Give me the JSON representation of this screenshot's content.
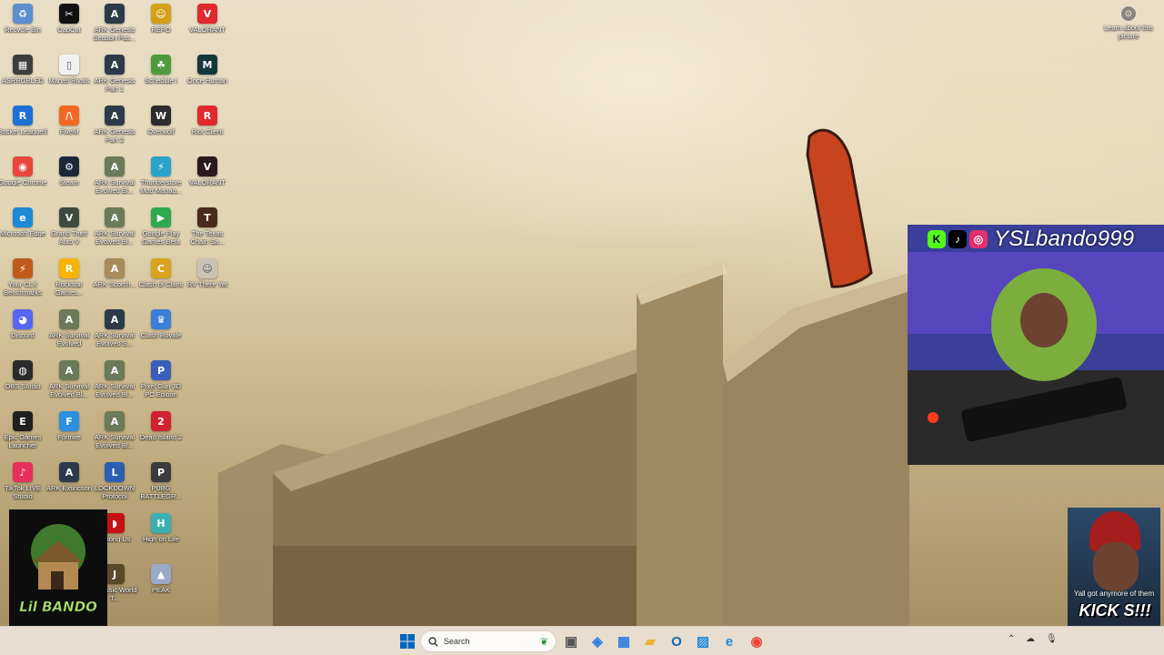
{
  "desktop": {
    "icons": [
      {
        "label": "Recycle Bin",
        "icon": "recycle-bin-icon",
        "color": "#5b8fcf",
        "glyph": "♻"
      },
      {
        "label": "CapCut",
        "icon": "capcut-icon",
        "color": "#111111",
        "glyph": "✂"
      },
      {
        "label": "ARK Genesis Season Pas...",
        "icon": "ark-icon",
        "color": "#2d3a4a",
        "glyph": "A"
      },
      {
        "label": "REPO",
        "icon": "repo-icon",
        "color": "#d4a017",
        "glyph": "☺"
      },
      {
        "label": "VALORANT",
        "icon": "valorant-icon",
        "color": "#e0282e",
        "glyph": "V"
      },
      {
        "label": "ASRRGBLED",
        "icon": "asrock-icon",
        "color": "#3d3d3d",
        "glyph": "▦"
      },
      {
        "label": "Marvel Rivals",
        "icon": "file-icon",
        "color": "#f2f2f2",
        "glyph": "▯"
      },
      {
        "label": "ARK Genesis Part 1",
        "icon": "ark-icon",
        "color": "#2d3a4a",
        "glyph": "A"
      },
      {
        "label": "Schedule I",
        "icon": "schedule-icon",
        "color": "#4e9a3f",
        "glyph": "☘"
      },
      {
        "label": "Once Human",
        "icon": "once-human-icon",
        "color": "#14373a",
        "glyph": "M"
      },
      {
        "label": "Rocket League®",
        "icon": "rocket-league-icon",
        "color": "#1e6fd6",
        "glyph": "R"
      },
      {
        "label": "FiveM",
        "icon": "fivem-icon",
        "color": "#f26722",
        "glyph": "/\\"
      },
      {
        "label": "ARK Genesis Part 2",
        "icon": "ark-icon",
        "color": "#2d3a4a",
        "glyph": "A"
      },
      {
        "label": "Overwolf",
        "icon": "overwolf-icon",
        "color": "#2b2b2b",
        "glyph": "W"
      },
      {
        "label": "Riot Client",
        "icon": "riot-icon",
        "color": "#e0282e",
        "glyph": "R"
      },
      {
        "label": "Google Chrome",
        "icon": "chrome-icon",
        "color": "#e8453c",
        "glyph": "◉"
      },
      {
        "label": "Steam",
        "icon": "steam-icon",
        "color": "#1b2838",
        "glyph": "⚙"
      },
      {
        "label": "ARK Survival Evolved Bl...",
        "icon": "ark-icon",
        "color": "#6b7a58",
        "glyph": "A"
      },
      {
        "label": "Thunderstore Mod Manag...",
        "icon": "thunderstore-icon",
        "color": "#2aa3c9",
        "glyph": "⚡"
      },
      {
        "label": "VALORANT",
        "icon": "valorant-icon",
        "color": "#2a1a1e",
        "glyph": "V"
      },
      {
        "label": "Microsoft Edge",
        "icon": "edge-icon",
        "color": "#1c8ad6",
        "glyph": "e"
      },
      {
        "label": "Grand Theft Auto V",
        "icon": "gta-icon",
        "color": "#3d4a3d",
        "glyph": "V"
      },
      {
        "label": "ARK Survival Evolved Bl...",
        "icon": "ark-icon",
        "color": "#6b7a58",
        "glyph": "A"
      },
      {
        "label": "Google Play Games Beta",
        "icon": "google-play-icon",
        "color": "#2fa84f",
        "glyph": "▶"
      },
      {
        "label": "The Texas Chain Sa...",
        "icon": "texas-chainsaw-icon",
        "color": "#4a2a1a",
        "glyph": "T"
      },
      {
        "label": "Your CLX Benchmarks",
        "icon": "clx-icon",
        "color": "#c05a1a",
        "glyph": "⚡"
      },
      {
        "label": "Rockstar Games...",
        "icon": "rockstar-icon",
        "color": "#f5b400",
        "glyph": "R"
      },
      {
        "label": "ARK Scorch...",
        "icon": "ark-icon",
        "color": "#a88b5a",
        "glyph": "A"
      },
      {
        "label": "Clash of Clans",
        "icon": "clash-of-clans-icon",
        "color": "#d9a21f",
        "glyph": "C"
      },
      {
        "label": "RV There Yet",
        "icon": "rv-icon",
        "color": "#c9c3b3",
        "glyph": "☺"
      },
      {
        "label": "Discord",
        "icon": "discord-icon",
        "color": "#5865f2",
        "glyph": "◕"
      },
      {
        "label": "ARK Survival Evolved",
        "icon": "ark-icon",
        "color": "#6b7a58",
        "glyph": "A"
      },
      {
        "label": "ARK Survival Evolved S...",
        "icon": "ark-icon",
        "color": "#2d3a4a",
        "glyph": "A"
      },
      {
        "label": "Clash Royale",
        "icon": "clash-royale-icon",
        "color": "#3a7fd5",
        "glyph": "♛"
      },
      {
        "label": "OBS Studio",
        "icon": "obs-icon",
        "color": "#2b2b2b",
        "glyph": "◍"
      },
      {
        "label": "ARK Survival Evolved Bl...",
        "icon": "ark-icon",
        "color": "#6b7a58",
        "glyph": "A"
      },
      {
        "label": "ARK Survival Evolved Bl...",
        "icon": "ark-icon",
        "color": "#6b7a58",
        "glyph": "A"
      },
      {
        "label": "Pixel Gun 3D PC Edition",
        "icon": "pixel-gun-icon",
        "color": "#3b5fb8",
        "glyph": "P"
      },
      {
        "label": "Epic Games Launcher",
        "icon": "epic-games-icon",
        "color": "#1f1f1f",
        "glyph": "E"
      },
      {
        "label": "Fortnite",
        "icon": "fortnite-icon",
        "color": "#2c8fe0",
        "glyph": "F"
      },
      {
        "label": "ARK Survival Evolved Bl...",
        "icon": "ark-icon",
        "color": "#6b7a58",
        "glyph": "A"
      },
      {
        "label": "Dead Island 2",
        "icon": "dead-island-icon",
        "color": "#d02232",
        "glyph": "2"
      },
      {
        "label": "TikTok LIVE Studio",
        "icon": "tiktok-live-icon",
        "color": "#e8305a",
        "glyph": "♪"
      },
      {
        "label": "ARK Extinction",
        "icon": "ark-icon",
        "color": "#2d3a4a",
        "glyph": "A"
      },
      {
        "label": "LOCKDOWN Protocol",
        "icon": "lockdown-icon",
        "color": "#2c5fb0",
        "glyph": "L"
      },
      {
        "label": "PUBG BATTLEGR...",
        "icon": "pubg-icon",
        "color": "#3b3b3b",
        "glyph": "P"
      },
      {
        "label": "Among Us",
        "icon": "among-us-icon",
        "color": "#c51111",
        "glyph": "◗"
      },
      {
        "label": "High on Life",
        "icon": "high-on-life-icon",
        "color": "#3cb0b0",
        "glyph": "H"
      },
      {
        "label": "Jurassic World T...",
        "icon": "jurassic-icon",
        "color": "#5a4a2a",
        "glyph": "J"
      },
      {
        "label": "PEAK",
        "icon": "peak-icon",
        "color": "#9aa9c8",
        "glyph": "▲"
      }
    ]
  },
  "learn_about_picture": {
    "label": "Learn about this picture",
    "icon": "camera-icon"
  },
  "stream_overlay": {
    "handle": "YSLbando999",
    "socials": [
      {
        "icon": "kick-icon",
        "glyph": "K",
        "color": "#53fc18"
      },
      {
        "icon": "tiktok-icon",
        "glyph": "♪",
        "color": "#ffffff"
      },
      {
        "icon": "instagram-icon",
        "glyph": "◎",
        "color": "#e1306c"
      }
    ],
    "meme_caption": "Yall got anymore of them",
    "meme_kick": "KICK S!!!",
    "logo_text": "Lil BANDO"
  },
  "taskbar": {
    "search_placeholder": "Search",
    "accent": "#0067c0",
    "pinned": [
      {
        "icon": "task-view-icon",
        "glyph": "▣",
        "color": "#555555"
      },
      {
        "icon": "copilot-icon",
        "glyph": "◈",
        "color": "#2f7de1"
      },
      {
        "icon": "microsoft-store-icon",
        "glyph": "▦",
        "color": "#2f7de1"
      },
      {
        "icon": "file-explorer-icon",
        "glyph": "▰",
        "color": "#e8b33a"
      },
      {
        "icon": "outlook-icon",
        "glyph": "O",
        "color": "#0f6cbd"
      },
      {
        "icon": "photos-icon",
        "glyph": "▨",
        "color": "#1b8ad9"
      },
      {
        "icon": "edge-icon",
        "glyph": "e",
        "color": "#1c8ad6"
      },
      {
        "icon": "chrome-icon",
        "glyph": "◉",
        "color": "#e8453c"
      }
    ]
  }
}
